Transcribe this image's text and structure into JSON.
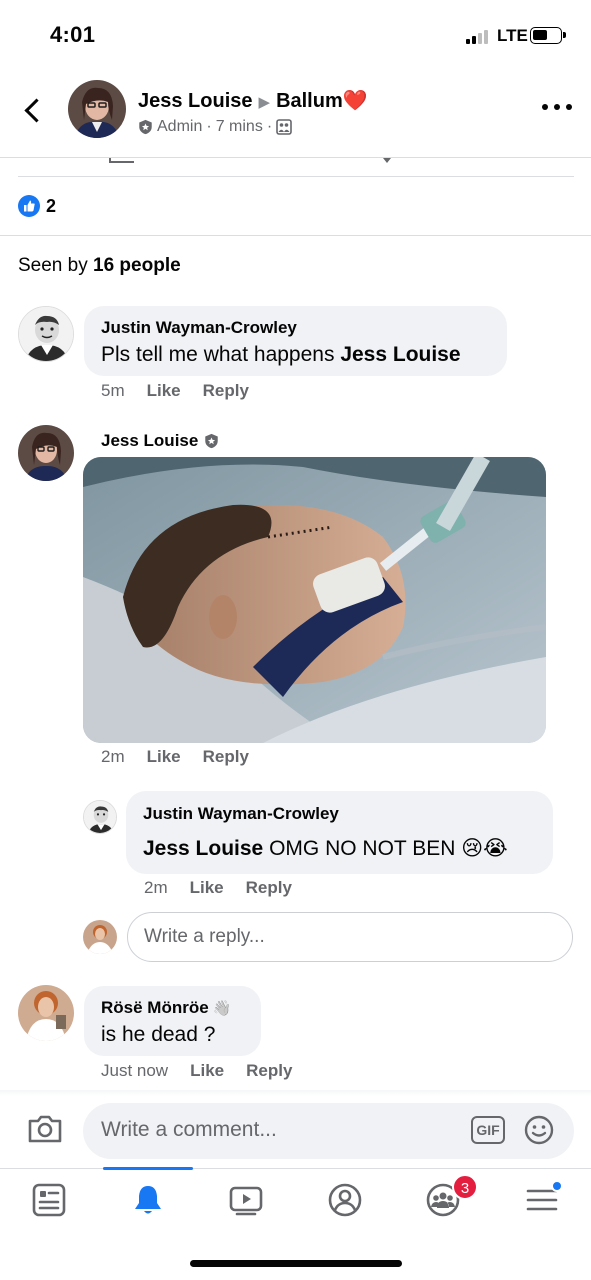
{
  "status": {
    "time": "4:01",
    "network": "LTE"
  },
  "header": {
    "author": "Jess Louise",
    "group": "Ballum",
    "heart": "❤️",
    "role": "Admin",
    "time": "7 mins",
    "separator": "·"
  },
  "reactions": {
    "count": "2"
  },
  "seen": {
    "prefix": "Seen by",
    "count": "16 people"
  },
  "comments": [
    {
      "name": "Justin Wayman-Crowley",
      "text": "Pls tell me what happens",
      "mention": "Jess Louise",
      "time": "5m",
      "like": "Like",
      "reply": "Reply"
    },
    {
      "name": "Jess Louise",
      "time": "2m",
      "like": "Like",
      "reply": "Reply",
      "reply_thread": {
        "name": "Justin Wayman-Crowley",
        "mention": "Jess Louise",
        "text": "OMG NO NOT BEN",
        "emojis": "😢😭",
        "time": "2m",
        "like": "Like",
        "reply": "Reply"
      },
      "reply_placeholder": "Write a reply..."
    },
    {
      "name": "Rösë Mönröe",
      "name_emoji": "👋",
      "text": "is he dead ?",
      "time": "Just now",
      "like": "Like",
      "reply": "Reply"
    }
  ],
  "composer": {
    "placeholder": "Write a comment...",
    "gif": "GIF"
  },
  "tabs": [
    {
      "icon": "news-feed-icon",
      "active": false
    },
    {
      "icon": "notifications-bell-icon",
      "active": true
    },
    {
      "icon": "watch-video-icon",
      "active": false
    },
    {
      "icon": "profile-icon",
      "active": false
    },
    {
      "icon": "groups-icon",
      "active": false,
      "badge": "3"
    },
    {
      "icon": "menu-icon",
      "active": false,
      "dot": true
    }
  ],
  "colors": {
    "accent": "#1877f2",
    "bubble": "#f0f2f5",
    "muted": "#65676b",
    "badge": "#e41e3f"
  }
}
